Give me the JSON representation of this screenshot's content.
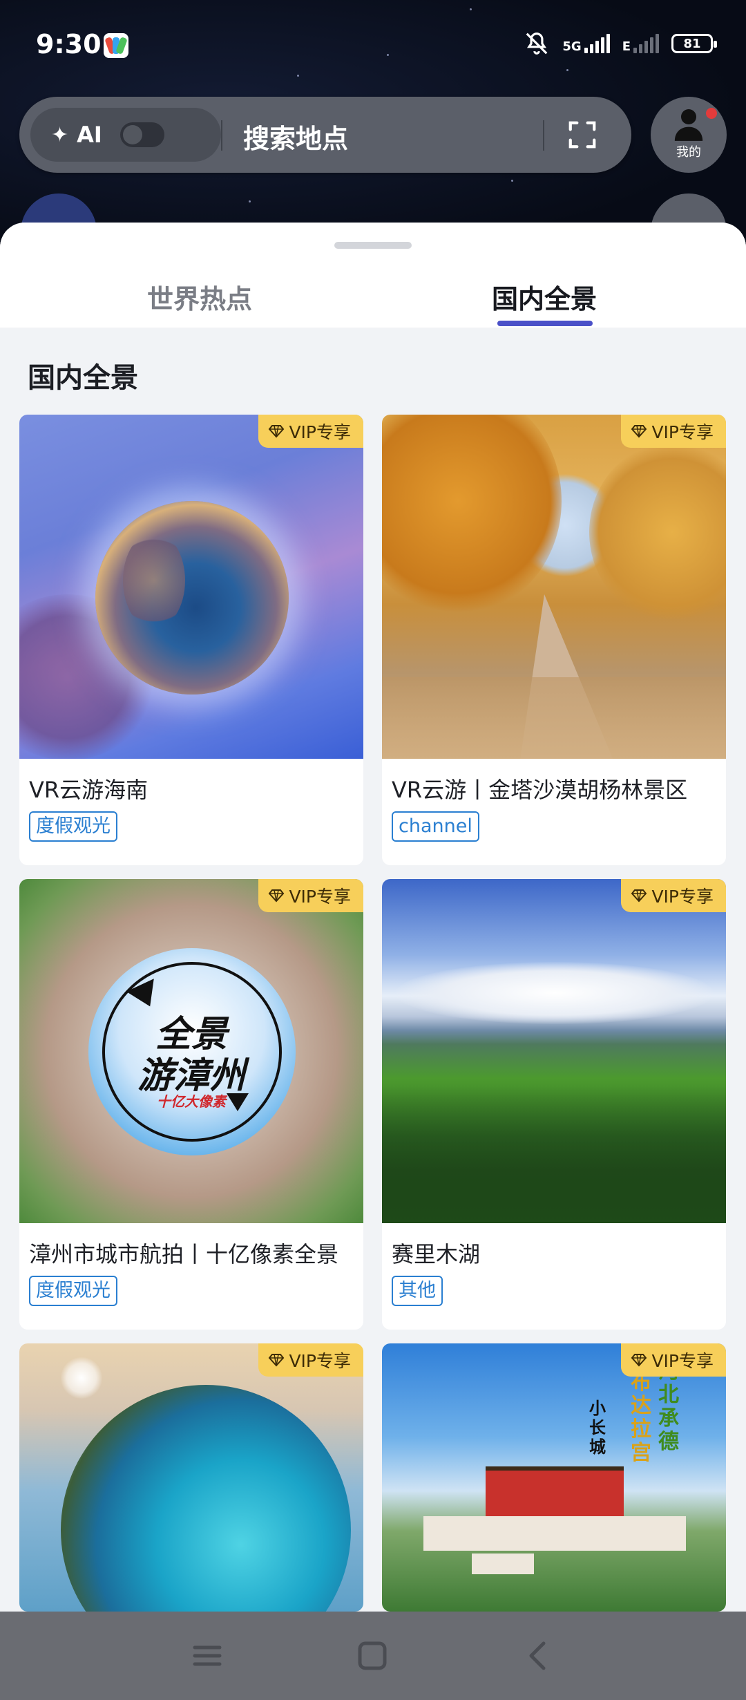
{
  "status_bar": {
    "time": "9:30",
    "network": "5G",
    "network2": "E",
    "battery": "81"
  },
  "search": {
    "ai_label": "AI",
    "placeholder": "搜索地点"
  },
  "profile": {
    "label": "我的"
  },
  "tabs": [
    {
      "label": "世界热点",
      "active": false
    },
    {
      "label": "国内全景",
      "active": true
    }
  ],
  "section_title": "国内全景",
  "vip_label": "VIP专享",
  "cards": [
    {
      "title": "VR云游海南",
      "tag": "度假观光"
    },
    {
      "title": "VR云游丨金塔沙漠胡杨林景区",
      "tag": "channel"
    },
    {
      "title": "漳州市城市航拍丨十亿像素全景",
      "tag": "度假观光",
      "image_text": [
        "全景",
        "游漳州",
        "十亿大像素"
      ]
    },
    {
      "title": "赛里木湖",
      "tag": "其他"
    },
    {
      "title": "",
      "tag": ""
    },
    {
      "title": "",
      "tag": "",
      "image_text": [
        "河北承德",
        "布达拉宫",
        "小长城"
      ]
    }
  ],
  "colors": {
    "accent": "#4a50c8",
    "vip_badge": "#f7cf5a",
    "tag_blue": "#2a7fd1"
  }
}
